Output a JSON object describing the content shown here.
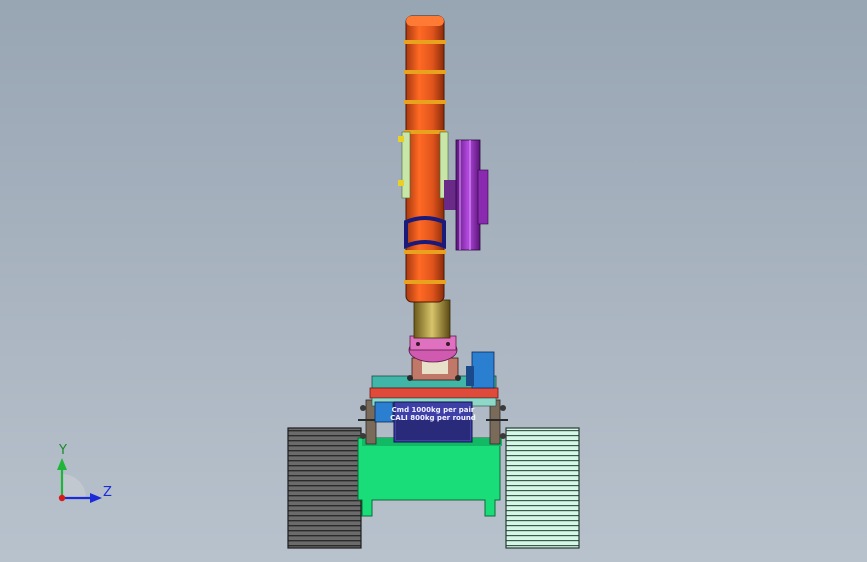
{
  "plate": {
    "line1": "Cmd 1000kg per pair",
    "line2": "CALI 800kg per round"
  },
  "triad": {
    "y_label": "Y",
    "z_label": "Z",
    "colors": {
      "y": "#1fb53a",
      "z": "#1a2bd8",
      "origin": "#d81a1a"
    }
  },
  "colors": {
    "background": "#a3afbc",
    "arm": "#e0541c",
    "arm_bands": "#e8a21e",
    "disc": "#9a2fc0",
    "chassis": "#18dd78",
    "track_left": "#5e5e5e",
    "track_right": "#c6f4e0",
    "motor": "#2a7fd0",
    "tray": "#e04a3a",
    "plate": "#3f3fa8"
  }
}
